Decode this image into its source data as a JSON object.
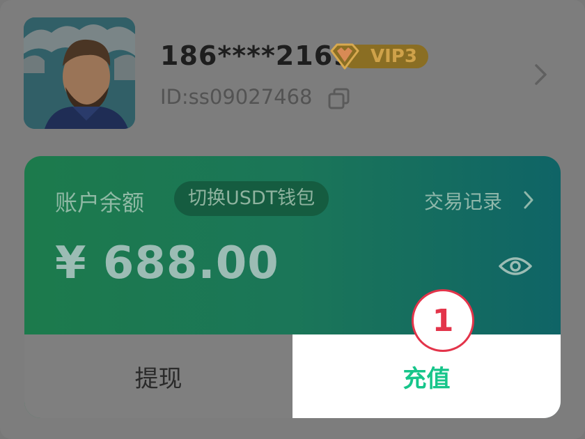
{
  "profile": {
    "username": "186****2169",
    "vip_label": "VIP3",
    "user_id": "ID:ss09027468"
  },
  "balance_card": {
    "label": "账户余额",
    "wallet_switch": "切换USDT钱包",
    "records_link": "交易记录",
    "amount": "¥ 688.00"
  },
  "actions": {
    "withdraw": "提现",
    "deposit": "充值"
  },
  "step_badge": "1",
  "colors": {
    "deposit_accent": "#16c58a",
    "badge_red": "#e3344a",
    "vip_gold": "#cfa24a",
    "card_green": "#1c7a4c"
  },
  "icons": [
    "avatar",
    "vip-gem-icon",
    "copy-icon",
    "chevron-right-icon",
    "eye-icon"
  ]
}
